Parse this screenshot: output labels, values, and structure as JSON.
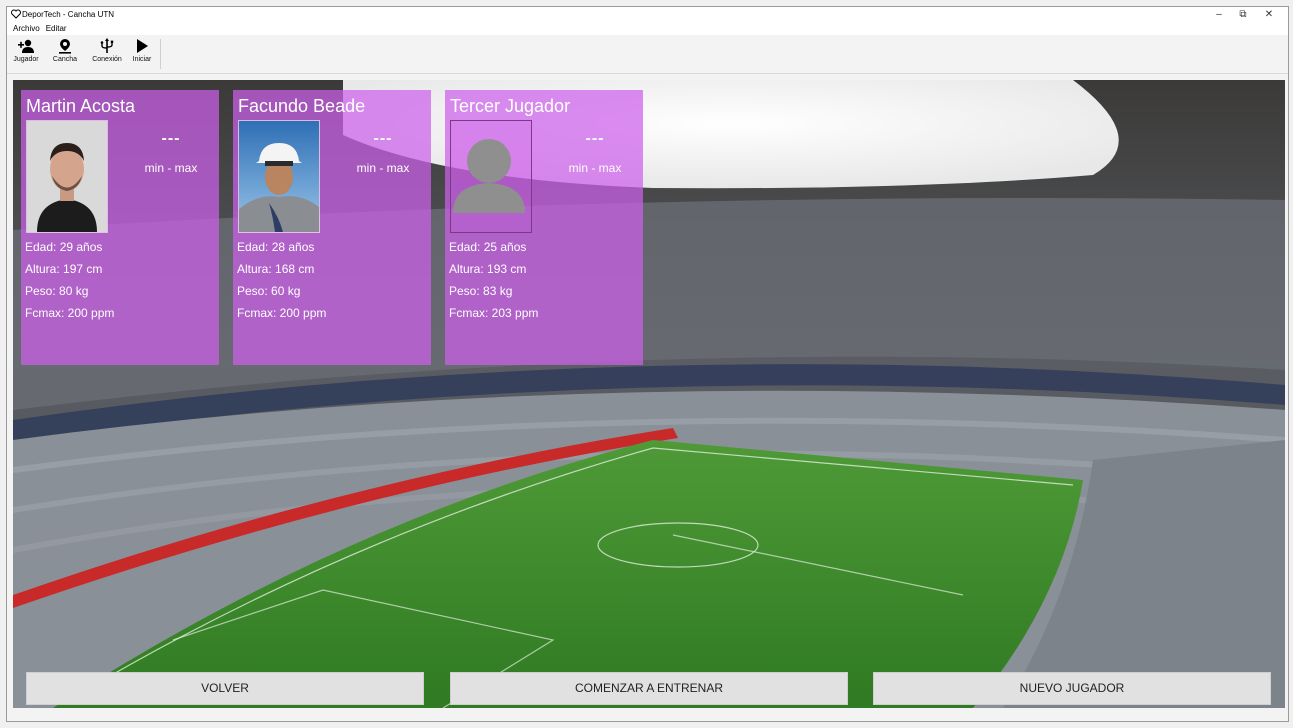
{
  "window": {
    "title": "DeporTech - Cancha UTN",
    "controls": [
      "–",
      "⧉",
      "✕"
    ]
  },
  "menu": [
    "Archivo",
    "Editar"
  ],
  "toolbar": [
    {
      "label": "Jugador",
      "icon": "add-user-icon"
    },
    {
      "label": "Cancha",
      "icon": "location-pin-icon"
    },
    {
      "label": "Conexión",
      "icon": "usb-icon"
    },
    {
      "label": "Iniciar",
      "icon": "play-icon"
    }
  ],
  "players": [
    {
      "name": "Martin Acosta",
      "hr": "---",
      "range": "min - max",
      "edad": "Edad: 29 años",
      "altura": "Altura: 197 cm",
      "peso": "Peso: 80 kg",
      "fcmax": "Fcmax: 200 ppm",
      "photo": "man-portrait"
    },
    {
      "name": "Facundo Beade",
      "hr": "---",
      "range": "min - max",
      "edad": "Edad: 28 años",
      "altura": "Altura: 168 cm",
      "peso": "Peso: 60 kg",
      "fcmax": "Fcmax: 200 ppm",
      "photo": "man-helmet-portrait"
    },
    {
      "name": "Tercer Jugador",
      "hr": "---",
      "range": "min - max",
      "edad": "Edad: 25 años",
      "altura": "Altura: 193 cm",
      "peso": "Peso: 83 kg",
      "fcmax": "Fcmax: 203 ppm",
      "photo": "default-avatar"
    }
  ],
  "buttons": {
    "back": "VOLVER",
    "start": "COMENZAR A ENTRENAR",
    "new_player": "NUEVO JUGADOR"
  },
  "colors": {
    "card": "#cd5feb",
    "pitch": "#3f8a2c"
  }
}
